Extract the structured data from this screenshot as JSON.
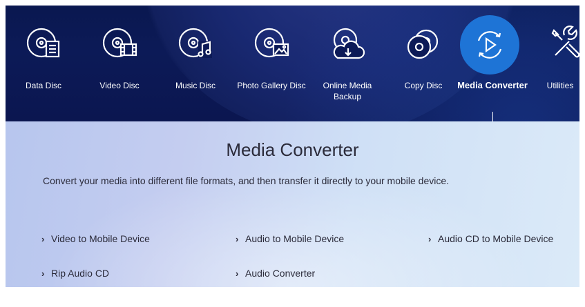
{
  "nav": {
    "items": [
      {
        "label": "Data Disc",
        "icon": "data-disc-icon"
      },
      {
        "label": "Video Disc",
        "icon": "video-disc-icon"
      },
      {
        "label": "Music Disc",
        "icon": "music-disc-icon"
      },
      {
        "label": "Photo Gallery Disc",
        "icon": "photo-gallery-disc-icon"
      },
      {
        "label": "Online Media Backup",
        "icon": "cloud-backup-icon"
      },
      {
        "label": "Copy Disc",
        "icon": "copy-disc-icon"
      },
      {
        "label": "Media Converter",
        "icon": "media-converter-icon",
        "active": true
      },
      {
        "label": "Utilities",
        "icon": "tools-icon"
      }
    ]
  },
  "main": {
    "title": "Media Converter",
    "description": "Convert your media into different file formats, and then transfer it directly to your mobile device.",
    "tasks": [
      {
        "label": "Video to Mobile Device"
      },
      {
        "label": "Audio to Mobile Device"
      },
      {
        "label": "Audio CD to Mobile Device"
      },
      {
        "label": "Rip Audio CD"
      },
      {
        "label": "Audio Converter"
      }
    ]
  },
  "colors": {
    "nav_background": "#0c1a57",
    "active_accent": "#1e74d6",
    "content_background": "#c4d2f2",
    "text": "#2b2b3a"
  }
}
